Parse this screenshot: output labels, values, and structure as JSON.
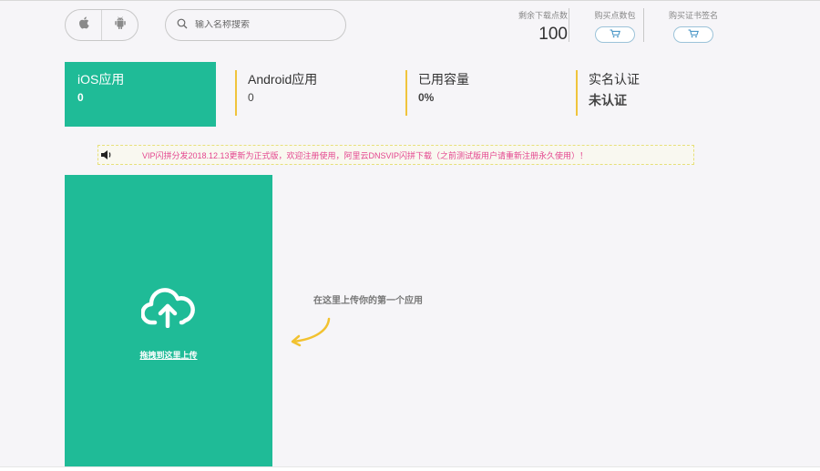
{
  "search": {
    "placeholder": "输入名称搜索"
  },
  "platform_toggle": {
    "items": [
      {
        "icon": "apple-icon"
      },
      {
        "icon": "android-icon"
      }
    ]
  },
  "stats": {
    "points_label": "剩余下载点数",
    "points_value": "100",
    "buy_points_label": "购买点数包",
    "buy_cert_label": "购买证书签名"
  },
  "cards": [
    {
      "title": "iOS应用",
      "value": "0"
    },
    {
      "title": "Android应用",
      "value": "0"
    },
    {
      "title": "已用容量",
      "value": "0%"
    },
    {
      "title": "实名认证",
      "value": "未认证"
    }
  ],
  "notice": {
    "text": "VIP闪拼分发2018.12.13更新为正式版，欢迎注册使用，阿里云DNSVIP闪拼下载（之前测试版用户请重新注册永久使用）！"
  },
  "upload": {
    "label": "拖拽到这里上传",
    "hint": "在这里上传你的第一个应用"
  },
  "colors": {
    "primary": "#1fbb97",
    "accent": "#f0c43c",
    "notice_text": "#e4468f"
  }
}
